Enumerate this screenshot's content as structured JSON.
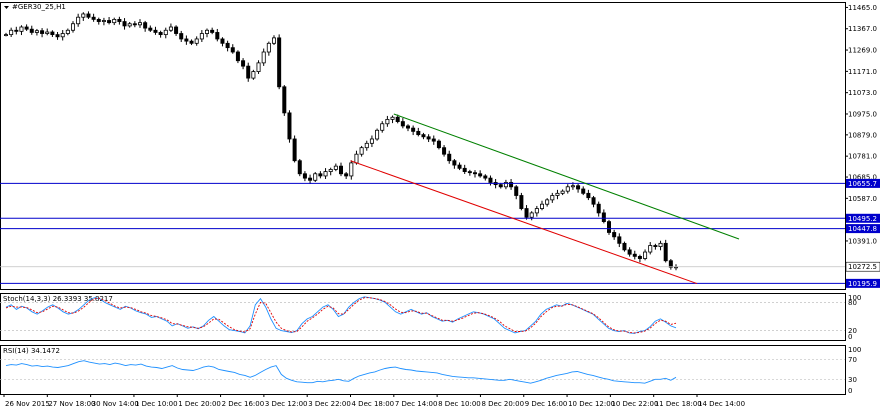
{
  "window": {
    "title": "#GER30_25,H1",
    "menu_icon": "triangle-down-icon"
  },
  "colors": {
    "candle_up": "#ffffff",
    "candle_down": "#000000",
    "hline": "#0000cc",
    "trend_upper": "#008000",
    "trend_lower": "#e00000",
    "stoch_main": "#1e90ff",
    "stoch_signal": "#e00000",
    "rsi": "#1e90ff",
    "tag_bg_blue": "#0000cc",
    "tag_bg_current": "#ffffff"
  },
  "chart_data": [
    {
      "type": "candlestick",
      "title": "#GER30_25,H1",
      "ylim": [
        10170,
        11490
      ],
      "y_ticks": [
        "11465.0",
        "11367.0",
        "11269.0",
        "11171.0",
        "11073.0",
        "10975.0",
        "10879.0",
        "10781.0",
        "10685.0",
        "10587.0",
        "10391.0"
      ],
      "x_ticks": [
        "26 Nov 2015",
        "27 Nov 18:00",
        "30 Nov 14:00",
        "1 Dec 10:00",
        "1 Dec 20:00",
        "2 Dec 16:00",
        "3 Dec 12:00",
        "3 Dec 22:00",
        "4 Dec 18:00",
        "7 Dec 14:00",
        "8 Dec 10:00",
        "8 Dec 20:00",
        "9 Dec 16:00",
        "10 Dec 12:00",
        "10 Dec 22:00",
        "11 Dec 18:00",
        "14 Dec 14:00"
      ],
      "close_path": [
        11340,
        11360,
        11355,
        11375,
        11365,
        11350,
        11358,
        11345,
        11352,
        11340,
        11330,
        11345,
        11360,
        11390,
        11420,
        11435,
        11420,
        11410,
        11400,
        11405,
        11395,
        11410,
        11400,
        11380,
        11390,
        11385,
        11395,
        11370,
        11360,
        11350,
        11340,
        11360,
        11375,
        11345,
        11320,
        11310,
        11300,
        11320,
        11345,
        11360,
        11350,
        11320,
        11300,
        11280,
        11260,
        11220,
        11195,
        11140,
        11170,
        11210,
        11260,
        11300,
        11325,
        11100,
        10980,
        10860,
        10760,
        10700,
        10680,
        10670,
        10700,
        10690,
        10710,
        10720,
        10735,
        10700,
        10690,
        10750,
        10790,
        10820,
        10840,
        10860,
        10900,
        10930,
        10950,
        10960,
        10940,
        10920,
        10910,
        10895,
        10880,
        10870,
        10860,
        10850,
        10820,
        10790,
        10760,
        10740,
        10725,
        10710,
        10705,
        10700,
        10690,
        10680,
        10660,
        10650,
        10640,
        10660,
        10640,
        10600,
        10540,
        10500,
        10520,
        10540,
        10560,
        10580,
        10600,
        10610,
        10620,
        10640,
        10645,
        10630,
        10610,
        10590,
        10560,
        10520,
        10480,
        10430,
        10410,
        10380,
        10350,
        10330,
        10320,
        10310,
        10340,
        10370,
        10365,
        10380,
        10300,
        10270,
        10272
      ],
      "horizontal_lines": [
        {
          "value": 10655.7,
          "label": "10655.7"
        },
        {
          "value": 10495.2,
          "label": "10495.2"
        },
        {
          "value": 10447.8,
          "label": "10447.8"
        },
        {
          "value": 10195.9,
          "label": "10195.9"
        }
      ],
      "current_price": {
        "value": 10272.5,
        "label": "10272.5"
      },
      "trendlines": [
        {
          "name": "upper",
          "from": {
            "x": "7 Dec 14:00",
            "y": 10975
          },
          "to": {
            "x": "14 Dec 20:00",
            "y": 10400
          }
        },
        {
          "name": "lower",
          "from": {
            "x": "4 Dec 18:00",
            "y": 10760
          },
          "to": {
            "x": "14 Dec 14:00",
            "y": 10195
          }
        }
      ]
    },
    {
      "type": "line",
      "title": "Stoch(14,3,3) 26.3393 35.8217",
      "ylim": [
        0,
        100
      ],
      "y_ticks": [
        "100",
        "80",
        "20",
        "0"
      ],
      "series": [
        {
          "name": "main",
          "values": [
            70,
            75,
            65,
            72,
            68,
            60,
            55,
            62,
            70,
            75,
            68,
            60,
            55,
            58,
            65,
            75,
            85,
            90,
            88,
            80,
            75,
            70,
            65,
            72,
            68,
            62,
            58,
            55,
            48,
            50,
            45,
            40,
            30,
            35,
            30,
            25,
            28,
            24,
            30,
            42,
            50,
            40,
            30,
            22,
            20,
            18,
            15,
            30,
            75,
            88,
            70,
            45,
            25,
            20,
            18,
            16,
            20,
            35,
            45,
            50,
            60,
            70,
            75,
            65,
            50,
            55,
            70,
            80,
            88,
            92,
            90,
            88,
            85,
            80,
            70,
            60,
            55,
            60,
            65,
            60,
            55,
            58,
            50,
            45,
            40,
            42,
            38,
            45,
            50,
            55,
            60,
            58,
            55,
            50,
            45,
            35,
            25,
            20,
            15,
            18,
            20,
            30,
            40,
            55,
            65,
            70,
            75,
            72,
            78,
            75,
            70,
            65,
            60,
            55,
            45,
            35,
            25,
            20,
            18,
            20,
            15,
            14,
            18,
            20,
            28,
            40,
            45,
            38,
            30,
            26
          ]
        },
        {
          "name": "signal",
          "values": [
            68,
            72,
            70,
            70,
            69,
            64,
            58,
            60,
            66,
            72,
            70,
            64,
            58,
            57,
            62,
            70,
            80,
            88,
            89,
            84,
            78,
            72,
            68,
            70,
            69,
            65,
            60,
            57,
            52,
            50,
            47,
            43,
            35,
            34,
            31,
            28,
            27,
            25,
            28,
            36,
            45,
            44,
            36,
            28,
            22,
            19,
            17,
            24,
            55,
            80,
            78,
            58,
            38,
            25,
            20,
            17,
            18,
            28,
            40,
            47,
            55,
            65,
            72,
            68,
            56,
            55,
            65,
            76,
            85,
            90,
            90,
            88,
            86,
            82,
            75,
            66,
            59,
            58,
            62,
            61,
            57,
            57,
            52,
            47,
            42,
            42,
            40,
            43,
            47,
            52,
            57,
            58,
            56,
            52,
            47,
            40,
            30,
            24,
            18,
            18,
            19,
            26,
            36,
            50,
            60,
            68,
            72,
            72,
            76,
            75,
            71,
            66,
            61,
            56,
            48,
            38,
            28,
            22,
            19,
            19,
            16,
            15,
            16,
            19,
            25,
            35,
            42,
            40,
            33,
            35.8
          ]
        }
      ]
    },
    {
      "type": "line",
      "title": "RSI(14) 34.1472",
      "ylim": [
        0,
        100
      ],
      "y_ticks": [
        "100",
        "70",
        "30",
        "0"
      ],
      "series": [
        {
          "name": "rsi",
          "values": [
            58,
            60,
            59,
            62,
            60,
            57,
            58,
            56,
            57,
            55,
            54,
            56,
            58,
            62,
            66,
            68,
            65,
            63,
            61,
            62,
            60,
            63,
            61,
            58,
            60,
            59,
            61,
            57,
            55,
            54,
            52,
            55,
            58,
            53,
            50,
            49,
            48,
            51,
            55,
            57,
            55,
            50,
            48,
            46,
            44,
            40,
            38,
            34,
            38,
            44,
            50,
            55,
            58,
            40,
            32,
            28,
            25,
            24,
            23,
            23,
            26,
            25,
            27,
            28,
            30,
            27,
            26,
            32,
            37,
            40,
            43,
            45,
            49,
            52,
            54,
            55,
            52,
            50,
            49,
            47,
            46,
            45,
            44,
            43,
            40,
            38,
            36,
            35,
            34,
            33,
            33,
            32,
            31,
            30,
            29,
            28,
            28,
            30,
            28,
            26,
            24,
            22,
            25,
            28,
            32,
            35,
            38,
            40,
            42,
            45,
            46,
            43,
            40,
            38,
            35,
            32,
            30,
            27,
            26,
            25,
            24,
            23,
            23,
            22,
            26,
            30,
            30,
            32,
            28,
            34.1
          ]
        }
      ]
    }
  ]
}
